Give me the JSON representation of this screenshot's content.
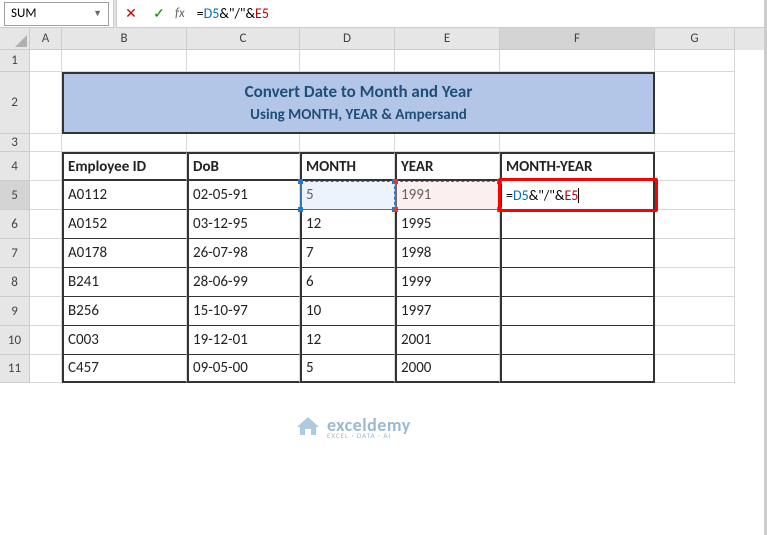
{
  "namebox": "SUM",
  "formula_parts": {
    "eq": "=",
    "ref1": "D5",
    "amp1": "&\"/\"&",
    "ref2": "E5"
  },
  "columns": [
    "A",
    "B",
    "C",
    "D",
    "E",
    "F",
    "G"
  ],
  "rows": [
    "1",
    "2",
    "3",
    "4",
    "5",
    "6",
    "7",
    "8",
    "9",
    "10",
    "11"
  ],
  "title_line1": "Convert Date to Month and Year",
  "title_line2": "Using MONTH, YEAR & Ampersand",
  "headers": {
    "b": "Employee ID",
    "c": "DoB",
    "d": "MONTH",
    "e": "YEAR",
    "f": "MONTH-YEAR"
  },
  "data": [
    {
      "b": "A0112",
      "c": "02-05-91",
      "d": "5",
      "e": "1991"
    },
    {
      "b": "A0152",
      "c": "03-12-95",
      "d": "12",
      "e": "1995"
    },
    {
      "b": "A0178",
      "c": "26-07-98",
      "d": "7",
      "e": "1998"
    },
    {
      "b": "B241",
      "c": "28-06-99",
      "d": "6",
      "e": "1999"
    },
    {
      "b": "B256",
      "c": "15-10-97",
      "d": "10",
      "e": "1997"
    },
    {
      "b": "C003",
      "c": "19-12-01",
      "d": "12",
      "e": "2001"
    },
    {
      "b": "C457",
      "c": "09-05-00",
      "d": "5",
      "e": "2000"
    }
  ],
  "active_cell_formula": {
    "eq": "=",
    "ref1": "D5",
    "amp1": "&\"/\"&",
    "ref2": "E5"
  },
  "watermark": {
    "brand": "exceldemy",
    "tagline": "EXCEL · DATA · AI"
  },
  "chart_data": {
    "type": "table",
    "title": "Convert Date to Month and Year Using MONTH, YEAR & Ampersand",
    "columns": [
      "Employee ID",
      "DoB",
      "MONTH",
      "YEAR",
      "MONTH-YEAR"
    ],
    "rows": [
      [
        "A0112",
        "02-05-91",
        5,
        1991,
        "=D5&\"/\"&E5"
      ],
      [
        "A0152",
        "03-12-95",
        12,
        1995,
        ""
      ],
      [
        "A0178",
        "26-07-98",
        7,
        1998,
        ""
      ],
      [
        "B241",
        "28-06-99",
        6,
        1999,
        ""
      ],
      [
        "B256",
        "15-10-97",
        10,
        1997,
        ""
      ],
      [
        "C003",
        "19-12-01",
        12,
        2001,
        ""
      ],
      [
        "C457",
        "09-05-00",
        5,
        2000,
        ""
      ]
    ]
  }
}
